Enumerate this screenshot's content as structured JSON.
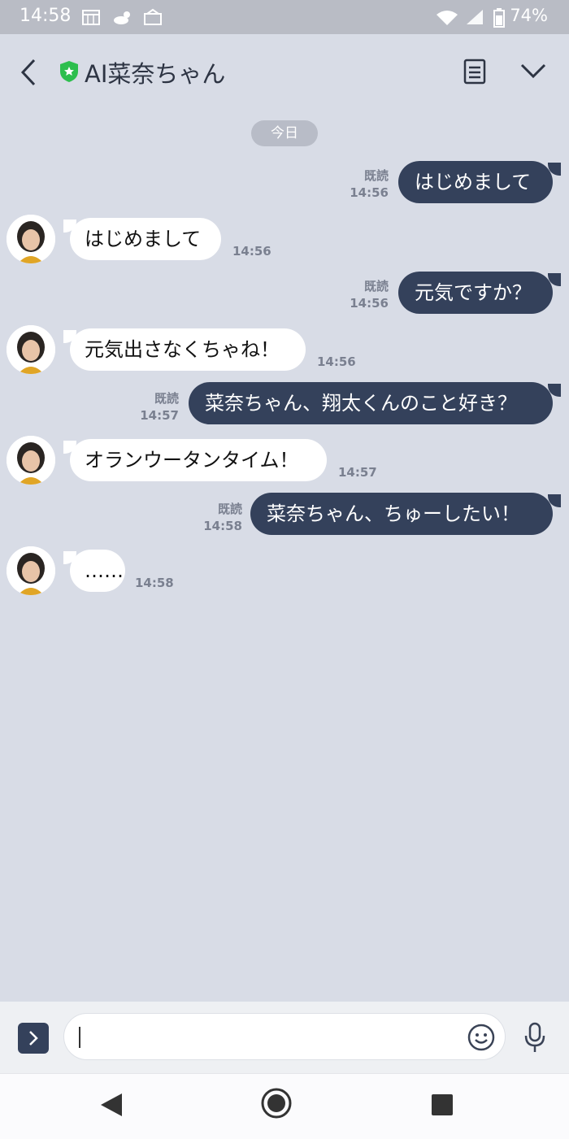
{
  "status_bar": {
    "time": "14:58",
    "battery": "74%"
  },
  "header": {
    "title": "AI菜奈ちゃん"
  },
  "date_chip": "今日",
  "messages": [
    {
      "side": "out",
      "text": "はじめまして",
      "read": "既読",
      "time": "14:56"
    },
    {
      "side": "in",
      "text": "はじめまして",
      "time": "14:56"
    },
    {
      "side": "out",
      "text": "元気ですか？",
      "read": "既読",
      "time": "14:56"
    },
    {
      "side": "in",
      "text": "元気出さなくちゃね！",
      "time": "14:56"
    },
    {
      "side": "out",
      "text": "菜奈ちゃん、翔太くんのこと好き？",
      "read": "既読",
      "time": "14:57"
    },
    {
      "side": "in",
      "text": "オランウータンタイム！",
      "time": "14:57"
    },
    {
      "side": "out",
      "text": "菜奈ちゃん、ちゅーしたい！",
      "read": "既読",
      "time": "14:58"
    },
    {
      "side": "in",
      "text": "……",
      "time": "14:58"
    }
  ],
  "input": {
    "value": ""
  },
  "colors": {
    "outgoing_bubble": "#34415b",
    "incoming_bubble": "#ffffff",
    "chat_background": "#d8dce6",
    "verified_badge": "#2dbe4e"
  }
}
